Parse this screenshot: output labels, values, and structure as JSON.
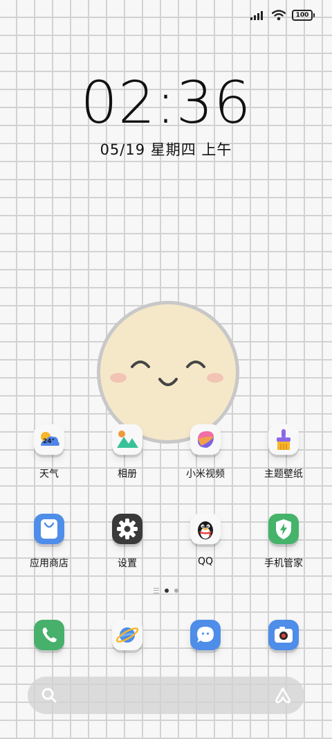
{
  "status_bar": {
    "battery": "100"
  },
  "lockscreen": {
    "time": "02:36",
    "date": "05/19 星期四 上午"
  },
  "apps_row1": [
    {
      "label": "天气",
      "temp": "24°"
    },
    {
      "label": "相册"
    },
    {
      "label": "小米视频"
    },
    {
      "label": "主题壁纸"
    }
  ],
  "apps_row2": [
    {
      "label": "应用商店"
    },
    {
      "label": "设置"
    },
    {
      "label": "QQ"
    },
    {
      "label": "手机管家"
    }
  ],
  "dock": [
    "phone-icon",
    "browser-icon",
    "messages-icon",
    "camera-icon"
  ],
  "page_indicator": {
    "pages": 2,
    "current": 1
  },
  "colors": {
    "background": "#f7f7f7",
    "grid": "#d2d2d2",
    "sun_face": "#f5e8c9",
    "blush": "#f2c4b4"
  }
}
